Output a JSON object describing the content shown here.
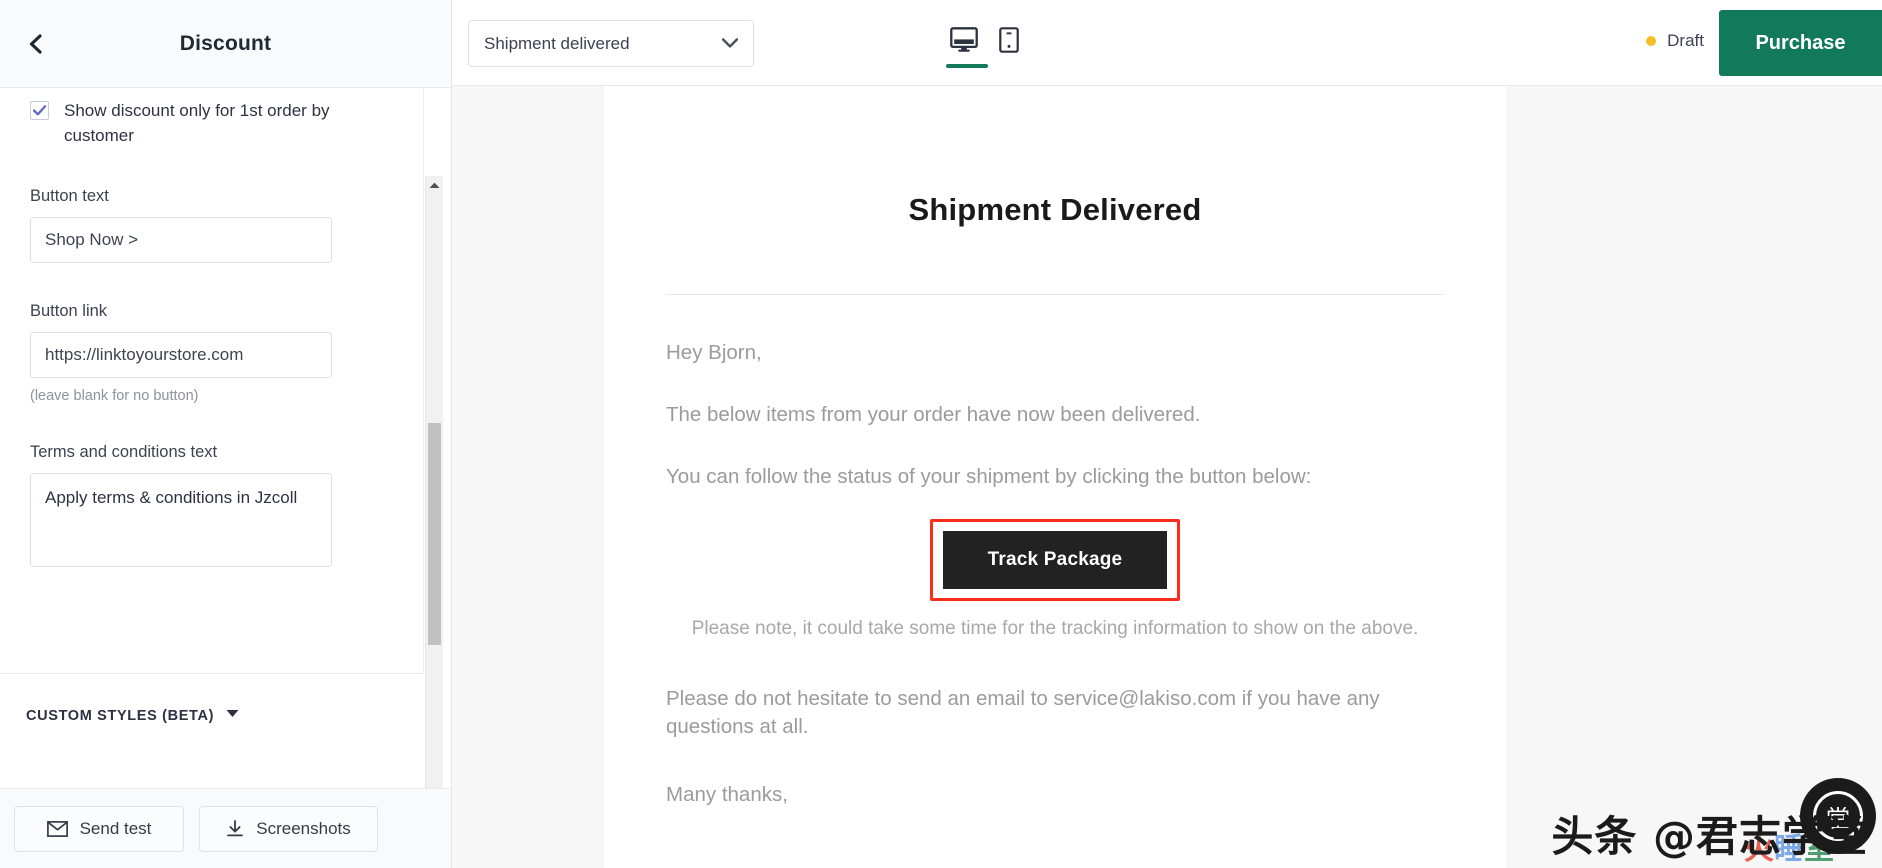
{
  "left_panel": {
    "back_icon": "chevron-left-icon",
    "title": "Discount",
    "checkbox": {
      "label": "Show discount only for 1st order by customer",
      "checked": true,
      "check_color": "#5c6bc0"
    },
    "fields": [
      {
        "label": "Button text",
        "value": "Shop Now >",
        "type": "text"
      },
      {
        "label": "Button link",
        "value": "https://linktoyourstore.com",
        "type": "text",
        "hint": "(leave blank for no button)"
      },
      {
        "label": "Terms and conditions text",
        "value": "Apply terms & conditions in Jzcoll",
        "type": "textarea"
      }
    ],
    "custom_styles": {
      "label": "CUSTOM STYLES (BETA)",
      "caret_icon": "caret-down-icon"
    },
    "bottom_bar": {
      "send_test": {
        "label": "Send test",
        "icon": "envelope-icon"
      },
      "screenshots": {
        "label": "Screenshots",
        "icon": "download-icon"
      }
    },
    "scrollbar": {
      "up_icon": "caret-up-icon",
      "down_icon": "caret-down-icon"
    }
  },
  "top_bar": {
    "template_select": {
      "value": "Shipment delivered",
      "caret_icon": "chevron-down-icon"
    },
    "devices": [
      {
        "name": "desktop",
        "icon": "desktop-monitor-icon",
        "active": true
      },
      {
        "name": "mobile",
        "icon": "mobile-phone-icon",
        "active": false
      }
    ],
    "status": {
      "label": "Draft",
      "dot_color": "#f5c026"
    },
    "purchase": {
      "label": "Purchase",
      "color": "#13795b"
    },
    "active_underline_color": "#13795b"
  },
  "email_preview": {
    "title": "Shipment Delivered",
    "greeting": "Hey Bjorn,",
    "paragraph_1": "The below items from your order have now been delivered.",
    "paragraph_2": "You can follow the status of your shipment by clicking the button below:",
    "cta": {
      "label": "Track Package",
      "background": "#222222",
      "selection_outline_color": "#fc2d1e"
    },
    "cta_note": "Please note, it could take some time for the tracking information to show on the above.",
    "support_line": "Please do not hesitate to send an email to service@lakiso.com if you have any questions at all.",
    "closing": "Many thanks,"
  },
  "watermark": {
    "text": "头条 @君志学堂",
    "sub_text_red": "火",
    "sub_text_blue": "睡",
    "sub_text_green": "室",
    "logo_glyph": "堂"
  }
}
